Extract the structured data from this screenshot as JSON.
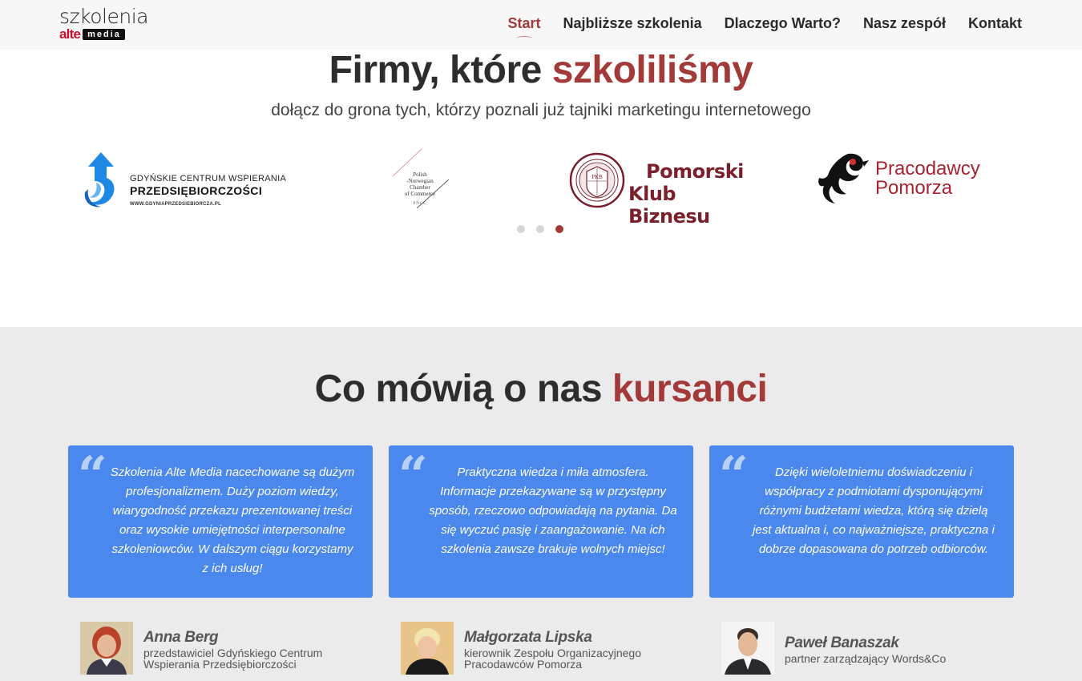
{
  "header": {
    "logo": {
      "line1": "szkolenia",
      "line2_brand": "alte",
      "line2_badge": "media"
    },
    "nav": [
      {
        "label": "Start",
        "active": true
      },
      {
        "label": "Najbliższe szkolenia",
        "active": false
      },
      {
        "label": "Dlaczego Warto?",
        "active": false
      },
      {
        "label": "Nasz zespół",
        "active": false
      },
      {
        "label": "Kontakt",
        "active": false
      }
    ]
  },
  "firms": {
    "title_plain": "Firmy, które ",
    "title_accent": "szkoliliśmy",
    "subtitle": "dołącz do grona tych, którzy poznali już tajniki marketingu internetowego",
    "clients": {
      "gcwp": {
        "line1": "GDYŃSKIE CENTRUM WSPIERANIA",
        "line2": "PRZEDSIĘBIORCZOŚCI",
        "line3": "WWW.GDYNIAPRZEDSIEBIORCZA.PL"
      },
      "pnc": {
        "line1": "Polish",
        "line2": "-Norwegian",
        "line3": "Chamber",
        "line4": "of Commerce",
        "line5": "PNCC"
      },
      "pkb": {
        "line1": "Pomorski",
        "line2": "Klub Biznesu",
        "seal_letters": "PKB"
      },
      "pp": {
        "line1": "Pracodawcy",
        "line2": "Pomorza"
      }
    },
    "carousel": {
      "dots": 3,
      "active_index": 2
    }
  },
  "testimonials": {
    "title_plain": "Co mówią o nas ",
    "title_accent": "kursanci",
    "items": [
      {
        "quote": "Szkolenia Alte Media nacechowane są dużym profesjonalizmem. Duży poziom wiedzy, wiarygodność przekazu prezentowanej treści oraz wysokie umiejętności interpersonalne szkoleniowców. W dalszym ciągu korzystamy z ich usług!",
        "name": "Anna Berg",
        "role": "przedstawiciel Gdyńskiego Centrum Wspierania Przedsiębiorczości"
      },
      {
        "quote": "Praktyczna wiedza i miła atmosfera. Informacje przekazywane są w przystępny sposób, rzeczowo odpowiadają na pytania. Da się wyczuć pasję i zaangażowanie. Na ich szkolenia zawsze brakuje wolnych miejsc!",
        "name": "Małgorzata Lipska",
        "role": "kierownik Zespołu Organizacyjnego Pracodawców Pomorza"
      },
      {
        "quote": "Dzięki wieloletniemu doświadczeniu i współpracy z podmiotami dysponującymi różnymi budżetami wiedza, którą się dzielą jest aktualna i, co najważniejsze, praktyczna i dobrze dopasowana do potrzeb odbiorców.",
        "name": "Paweł Banaszak",
        "role": "partner zarządzający Words&Co"
      }
    ]
  },
  "colors": {
    "accent": "#a33a3a",
    "card_blue": "#4a88ee",
    "section_gray": "#ebebeb",
    "header_bg": "#f7f7f7"
  }
}
